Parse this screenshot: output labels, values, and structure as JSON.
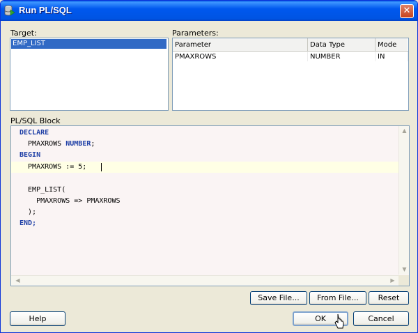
{
  "window": {
    "title": "Run PL/SQL"
  },
  "target": {
    "label": "Target:",
    "items": [
      "EMP_LIST"
    ]
  },
  "parameters": {
    "label": "Parameters:",
    "columns": [
      "Parameter",
      "Data Type",
      "Mode"
    ],
    "rows": [
      [
        "PMAXROWS",
        "NUMBER",
        "IN"
      ]
    ]
  },
  "block": {
    "label": "PL/SQL Block",
    "lines": [
      "DECLARE",
      "  PMAXROWS NUMBER;",
      "BEGIN",
      "  PMAXROWS := 5;",
      "",
      "  EMP_LIST(",
      "    PMAXROWS => PMAXROWS",
      "  );",
      "END;"
    ]
  },
  "buttons": {
    "save_file": "Save File...",
    "from_file": "From File...",
    "reset": "Reset",
    "help": "Help",
    "ok": "OK",
    "cancel": "Cancel"
  },
  "icons": {
    "title_icon": "database-run-icon",
    "close": "close-icon",
    "scroll_up": "arrow-up-icon",
    "scroll_down": "arrow-down-icon",
    "scroll_left": "arrow-left-icon",
    "scroll_right": "arrow-right-icon",
    "cursor": "mouse-pointer-icon"
  },
  "colors": {
    "titlebar": "#0054E3",
    "selection": "#316AC5",
    "keyword": "#1E3FA6",
    "current_line": "#FFFFE5",
    "close_button": "#C6431E"
  }
}
